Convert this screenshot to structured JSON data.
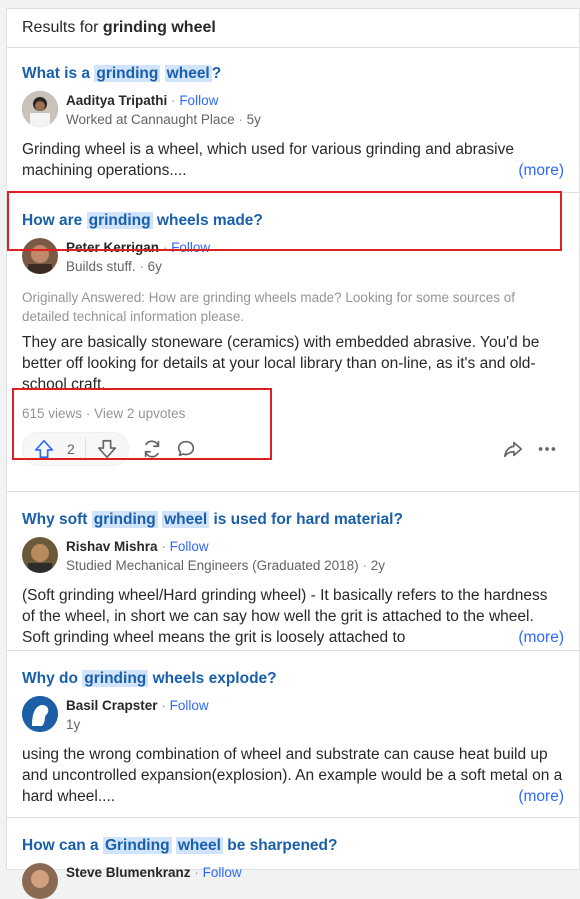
{
  "header": {
    "prefix": "Results for",
    "query": "grinding wheel"
  },
  "results": [
    {
      "title_parts": [
        "What is a ",
        "grinding",
        " ",
        "wheel",
        "?"
      ],
      "author": "Aaditya Tripathi",
      "follow": "Follow",
      "credential": "Worked at Cannaught Place",
      "age": "5y",
      "text": "Grinding wheel is a wheel, which used for various grinding and abrasive machining operations....",
      "more": "(more)"
    },
    {
      "title_parts": [
        "How are ",
        "grinding",
        " wheels made?"
      ],
      "author": "Peter Kerrigan",
      "follow": "Follow",
      "credential": "Builds stuff.",
      "age": "6y",
      "originally": "Originally Answered: How are grinding wheels made? Looking for some sources of detailed technical information please.",
      "text": "They are basically stoneware (ceramics) with embedded abrasive. You'd be better off looking for details at your local library than on-line, as it's and old-school craft.",
      "views": "615 views",
      "upvotes_link": "View 2 upvotes",
      "upvote_count": "2"
    },
    {
      "title_parts": [
        "Why soft ",
        "grinding",
        " ",
        "wheel",
        " is used for hard material?"
      ],
      "author": "Rishav Mishra",
      "follow": "Follow",
      "credential": "Studied Mechanical Engineers (Graduated 2018)",
      "age": "2y",
      "text": "(Soft grinding wheel/Hard grinding wheel) - It basically refers to the hardness of the wheel, in short we can say how well the grit is attached to the wheel. Soft grinding wheel means the grit is loosely attached to",
      "more": "(more)"
    },
    {
      "title_parts": [
        "Why do ",
        "grinding",
        " wheels explode?"
      ],
      "author": "Basil Crapster",
      "follow": "Follow",
      "credential": "",
      "age": "1y",
      "text": "using the wrong combination of wheel and substrate can cause heat build up and uncontrolled expansion(explosion). An example would be a soft metal on a hard wheel....",
      "more": "(more)"
    },
    {
      "title_parts": [
        "How can a ",
        "Grinding",
        " ",
        "wheel",
        " be sharpened?"
      ],
      "author": "Steve Blumenkranz",
      "follow": "Follow"
    }
  ],
  "colors": {
    "link": "#195faa",
    "highlight": "#d2e3fc",
    "follow": "#2e69ff",
    "annotation_box": "#e02020"
  }
}
